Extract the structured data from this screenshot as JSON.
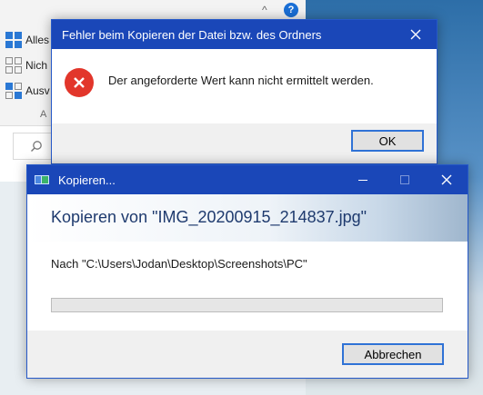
{
  "explorer": {
    "ribbon_items": [
      "Alles",
      "Nich",
      "Ausv"
    ],
    "group_label": "A",
    "help_label": "?"
  },
  "error_dialog": {
    "title": "Fehler beim Kopieren der Datei bzw. des Ordners",
    "message": "Der angeforderte Wert kann nicht ermittelt werden.",
    "ok_label": "OK",
    "close_icon": "close-icon",
    "error_icon": "error-icon"
  },
  "copy_dialog": {
    "title": "Kopieren...",
    "heading": "Kopieren von \"IMG_20200915_214837.jpg\"",
    "destination": "Nach \"C:\\Users\\Jodan\\Desktop\\Screenshots\\PC\"",
    "cancel_label": "Abbrechen",
    "progress": 0,
    "colors": {
      "titlebar": "#1a47b8",
      "progress_fill": "#06b025"
    }
  }
}
